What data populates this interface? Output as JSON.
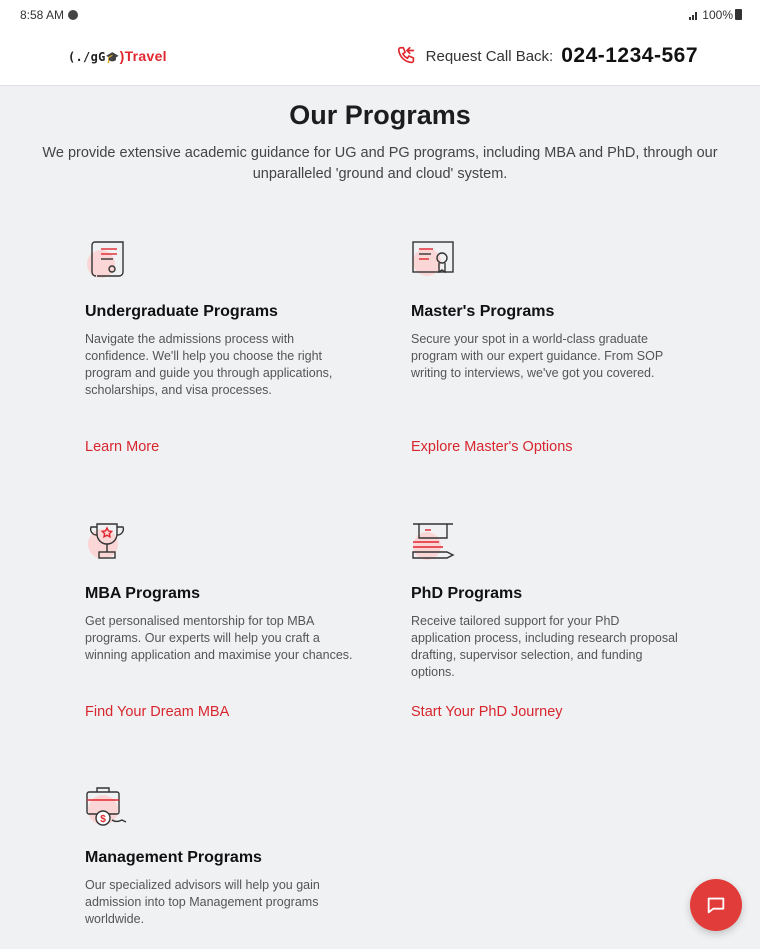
{
  "status_bar": {
    "time": "8:58 AM",
    "battery": "100%"
  },
  "header": {
    "logo_prefix": "(./gG",
    "logo_suffix": ")",
    "logo_brand": "Travel",
    "callback_label": "Request Call Back:",
    "callback_number": "024-1234-567",
    "accent_color": "#e0272f"
  },
  "main": {
    "title": "Our Programs",
    "intro": "We provide extensive academic guidance for UG and PG programs, including MBA and PhD, through our unparalleled 'ground and cloud' system."
  },
  "programs": [
    {
      "title": "Undergraduate Programs",
      "description": "Navigate the admissions process with confidence. We'll help you choose the right program and guide you through applications, scholarships, and visa processes.",
      "link": "Learn More",
      "icon": "scroll-certificate-icon"
    },
    {
      "title": "Master's Programs",
      "description": "Secure your spot in a world-class graduate program with our expert guidance. From SOP writing to interviews, we've got you covered.",
      "link": "Explore Master's Options",
      "icon": "diploma-certificate-icon"
    },
    {
      "title": "MBA Programs",
      "description": "Get personalised mentorship for top MBA programs. Our experts will help you craft a winning application and maximise your chances.",
      "link": "Find Your Dream MBA",
      "icon": "trophy-icon"
    },
    {
      "title": "PhD Programs",
      "description": "Receive tailored support for your PhD application process, including research proposal drafting, supervisor selection, and funding options.",
      "link": "Start Your PhD Journey",
      "icon": "graduation-books-icon"
    },
    {
      "title": "Management Programs",
      "description": "Our specialized advisors will help you gain admission into top Management programs worldwide.",
      "icon": "briefcase-dollar-icon"
    }
  ],
  "chat": {
    "icon": "chat-bubble-icon"
  }
}
